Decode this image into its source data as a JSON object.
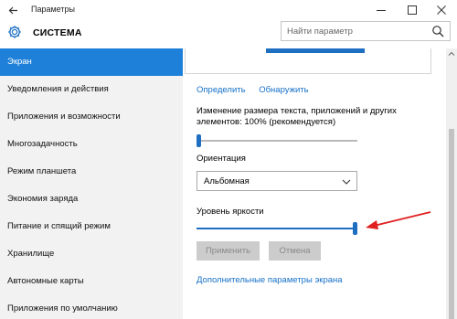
{
  "window": {
    "title": "Параметры",
    "back_icon": "back-arrow-icon",
    "controls": [
      "minimize-icon",
      "maximize-icon",
      "close-icon"
    ]
  },
  "header": {
    "section_title": "СИСТЕМА",
    "icon": "gear-icon",
    "search": {
      "placeholder": "Найти параметр",
      "value": ""
    }
  },
  "sidebar": {
    "items": [
      {
        "label": "Экран",
        "active": true
      },
      {
        "label": "Уведомления и действия"
      },
      {
        "label": "Приложения и возможности"
      },
      {
        "label": "Многозадачность"
      },
      {
        "label": "Режим планшета"
      },
      {
        "label": "Экономия заряда"
      },
      {
        "label": "Питание и спящий режим"
      },
      {
        "label": "Хранилище"
      },
      {
        "label": "Автономные карты"
      },
      {
        "label": "Приложения по умолчанию"
      }
    ]
  },
  "main": {
    "links": {
      "identify": "Определить",
      "detect": "Обнаружить"
    },
    "scale": {
      "label": "Изменение размера текста, приложений и других элементов: 100% (рекомендуется)",
      "value": 0.0
    },
    "orientation": {
      "label": "Ориентация",
      "selected": "Альбомная"
    },
    "brightness": {
      "label": "Уровень яркости",
      "value": 1.0
    },
    "buttons": {
      "apply": "Применить",
      "cancel": "Отмена"
    },
    "advanced_link": "Дополнительные параметры экрана"
  },
  "colors": {
    "accent": "#1e6fc2",
    "active_nav": "#1e80d8",
    "link": "#1670c7",
    "annotation_arrow": "#e02020"
  }
}
